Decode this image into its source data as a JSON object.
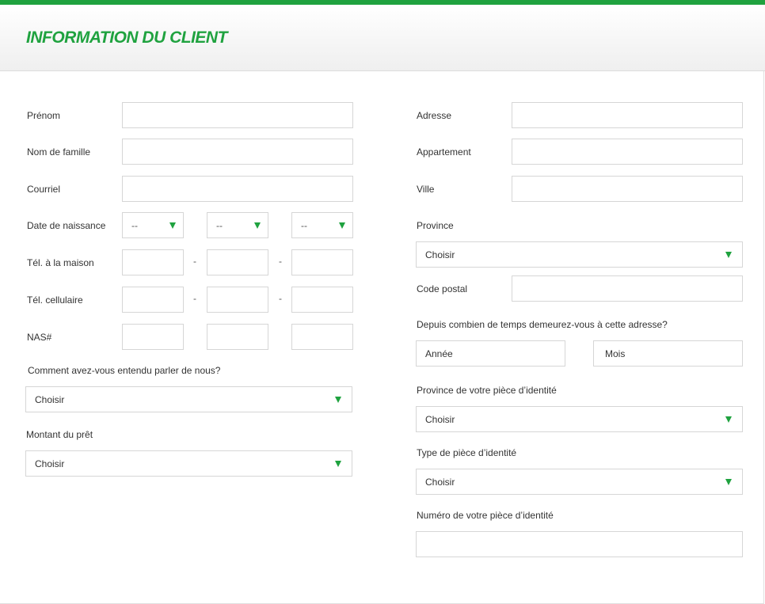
{
  "header": {
    "title": "INFORMATION DU CLIENT"
  },
  "colors": {
    "accent": "#1fa23f",
    "border": "#d6d6d6"
  },
  "left": {
    "first_name": {
      "label": "Prénom",
      "value": ""
    },
    "last_name": {
      "label": "Nom de famille",
      "value": ""
    },
    "email": {
      "label": "Courriel",
      "value": ""
    },
    "birth_date": {
      "label": "Date de naissance",
      "day": "--",
      "month": "--",
      "year": "--"
    },
    "home_phone": {
      "label": "Tél. à la maison",
      "separator": "-"
    },
    "cell_phone": {
      "label": "Tél. cellulaire",
      "separator": "-"
    },
    "sin": {
      "label": "NAS#"
    },
    "referral": {
      "label": "Comment avez-vous entendu parler de nous?",
      "selected": "Choisir"
    },
    "loan_amount": {
      "label": "Montant du prêt",
      "selected": "Choisir"
    }
  },
  "right": {
    "address": {
      "label": "Adresse",
      "value": ""
    },
    "apartment": {
      "label": "Appartement",
      "value": ""
    },
    "city": {
      "label": "Ville",
      "value": ""
    },
    "province": {
      "label": "Province",
      "selected": "Choisir"
    },
    "postal_code": {
      "label": "Code postal",
      "value": ""
    },
    "residence_duration": {
      "label": "Depuis combien de temps demeurez-vous à cette adresse?",
      "years_placeholder": "Année",
      "months_placeholder": "Mois"
    },
    "id_province": {
      "label": "Province de votre pièce d’identité",
      "selected": "Choisir"
    },
    "id_type": {
      "label": "Type de pièce d’identité",
      "selected": "Choisir"
    },
    "id_number": {
      "label": "Numéro de votre pièce d’identité",
      "value": ""
    }
  },
  "icons": {
    "dropdown": "chevron-down-icon"
  }
}
